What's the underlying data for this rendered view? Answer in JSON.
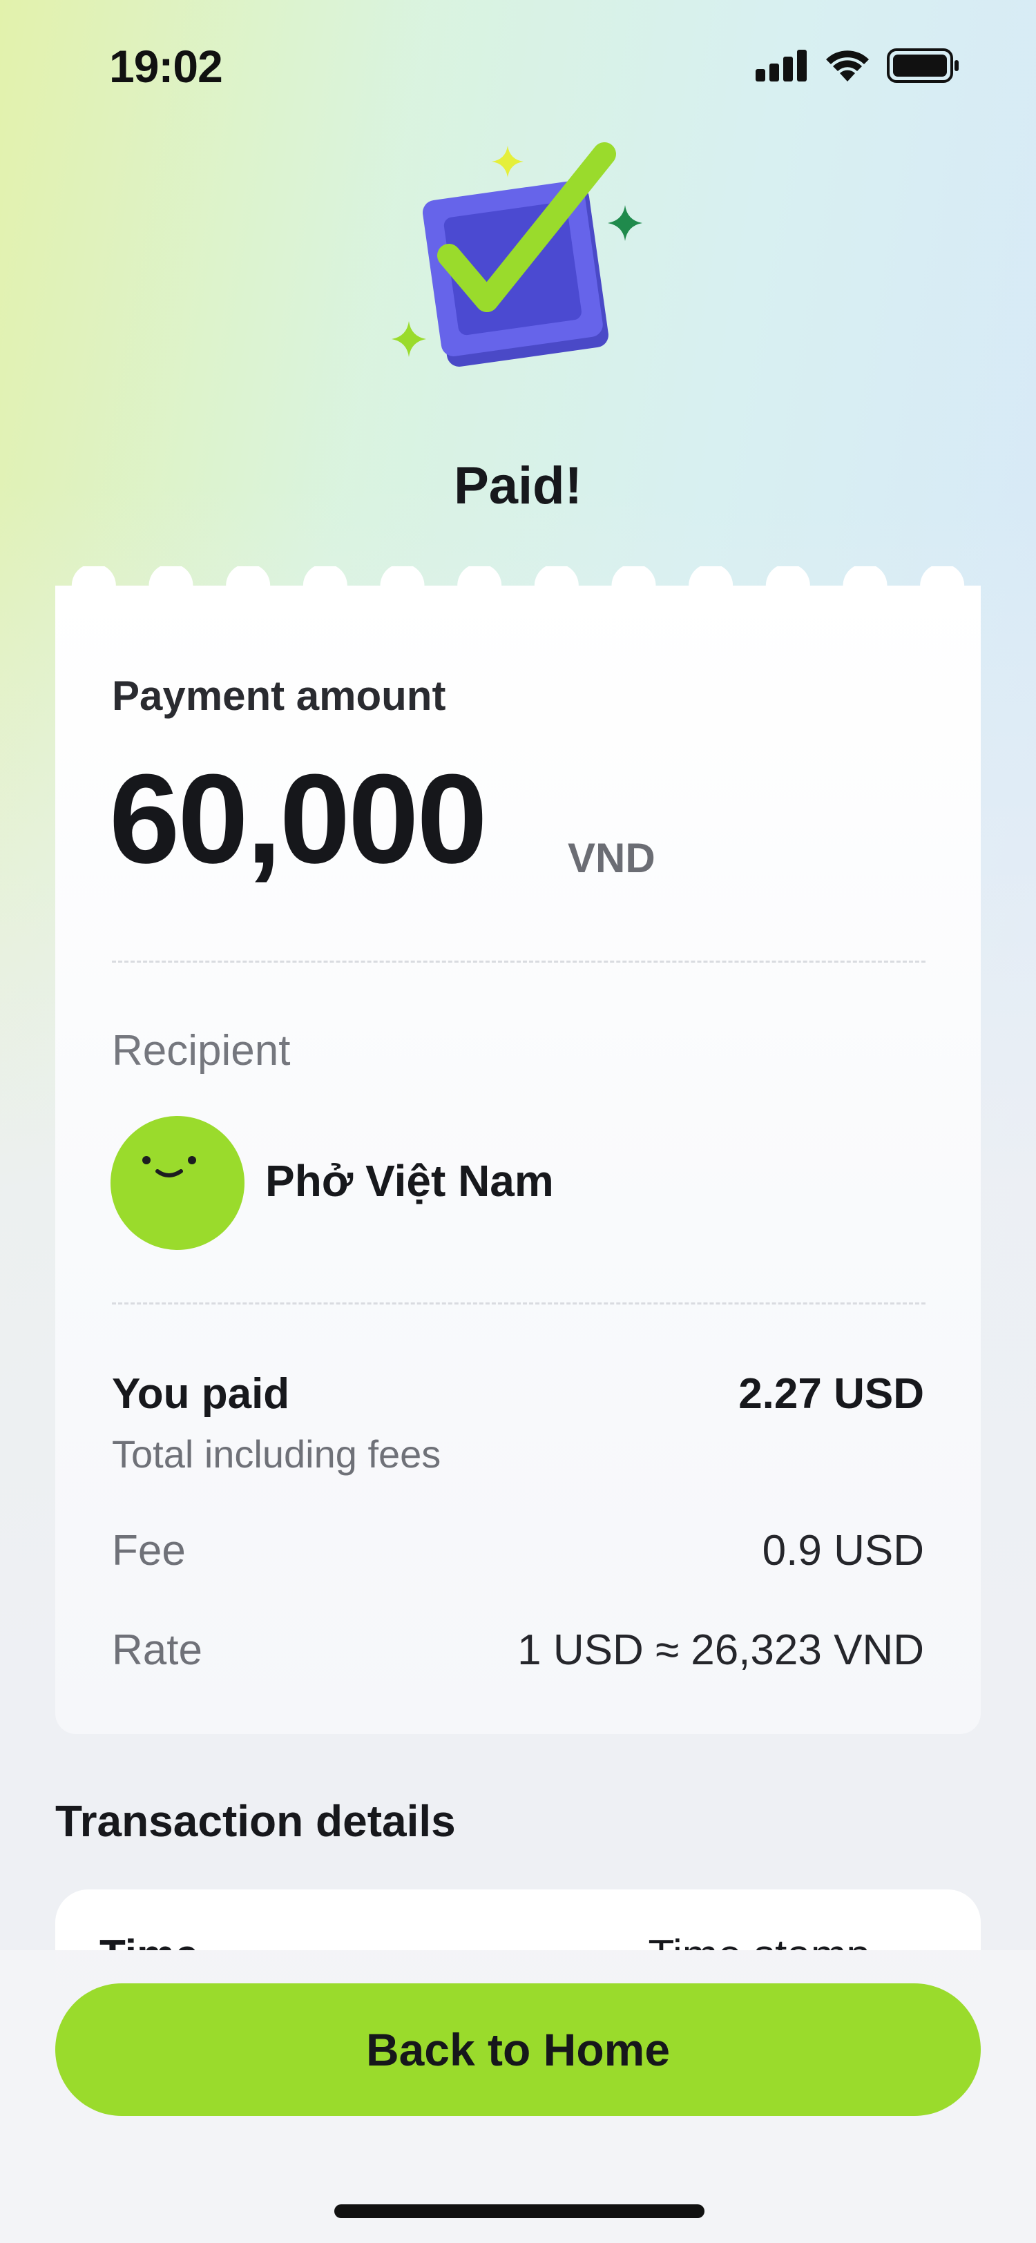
{
  "status_bar": {
    "time": "19:02"
  },
  "header": {
    "title": "Paid!"
  },
  "receipt": {
    "amount_label": "Payment amount",
    "amount": "60,000",
    "currency": "VND",
    "recipient_label": "Recipient",
    "recipient_name": "Phở Việt Nam",
    "you_paid_label": "You paid",
    "you_paid_value": "2.27 USD",
    "total_note": "Total including fees",
    "fee_label": "Fee",
    "fee_value": "0.9 USD",
    "rate_label": "Rate",
    "rate_value": "1 USD ≈ 26,323 VND"
  },
  "transaction_details": {
    "title": "Transaction details",
    "peek_left": "Time",
    "peek_right": "Time stamp"
  },
  "actions": {
    "back_home_label": "Back to Home"
  },
  "colors": {
    "accent_green": "#9adb2c",
    "icon_blue": "#5b5ae6",
    "sparkle_dark_green": "#1f8a4c",
    "sparkle_yellow": "#e5ef3a"
  },
  "icons": [
    "signal-icon",
    "wifi-icon",
    "battery-icon",
    "checkbox-success-illustration",
    "smiley-avatar-icon"
  ]
}
